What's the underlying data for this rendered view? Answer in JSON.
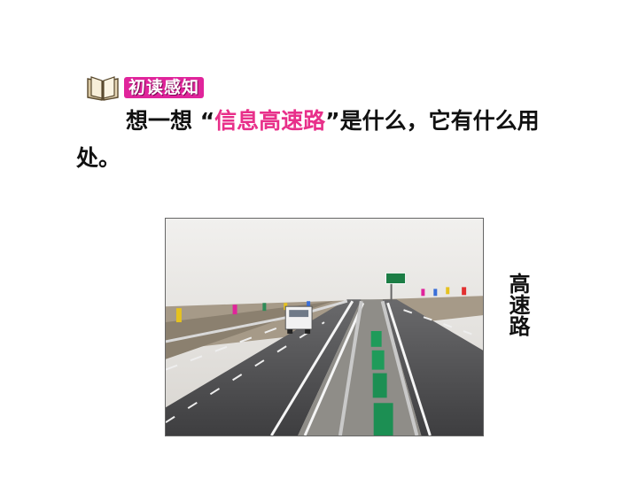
{
  "section": {
    "icon": "open-book-icon",
    "label": "初读感知",
    "label_color": "#e0249b"
  },
  "question": {
    "before": "想一想 “",
    "highlight": "信息高速路",
    "after": "”是什么，它有什么用处。",
    "highlight_color": "#e8308a"
  },
  "photo": {
    "subject": "highway"
  },
  "side_caption": "高速路"
}
